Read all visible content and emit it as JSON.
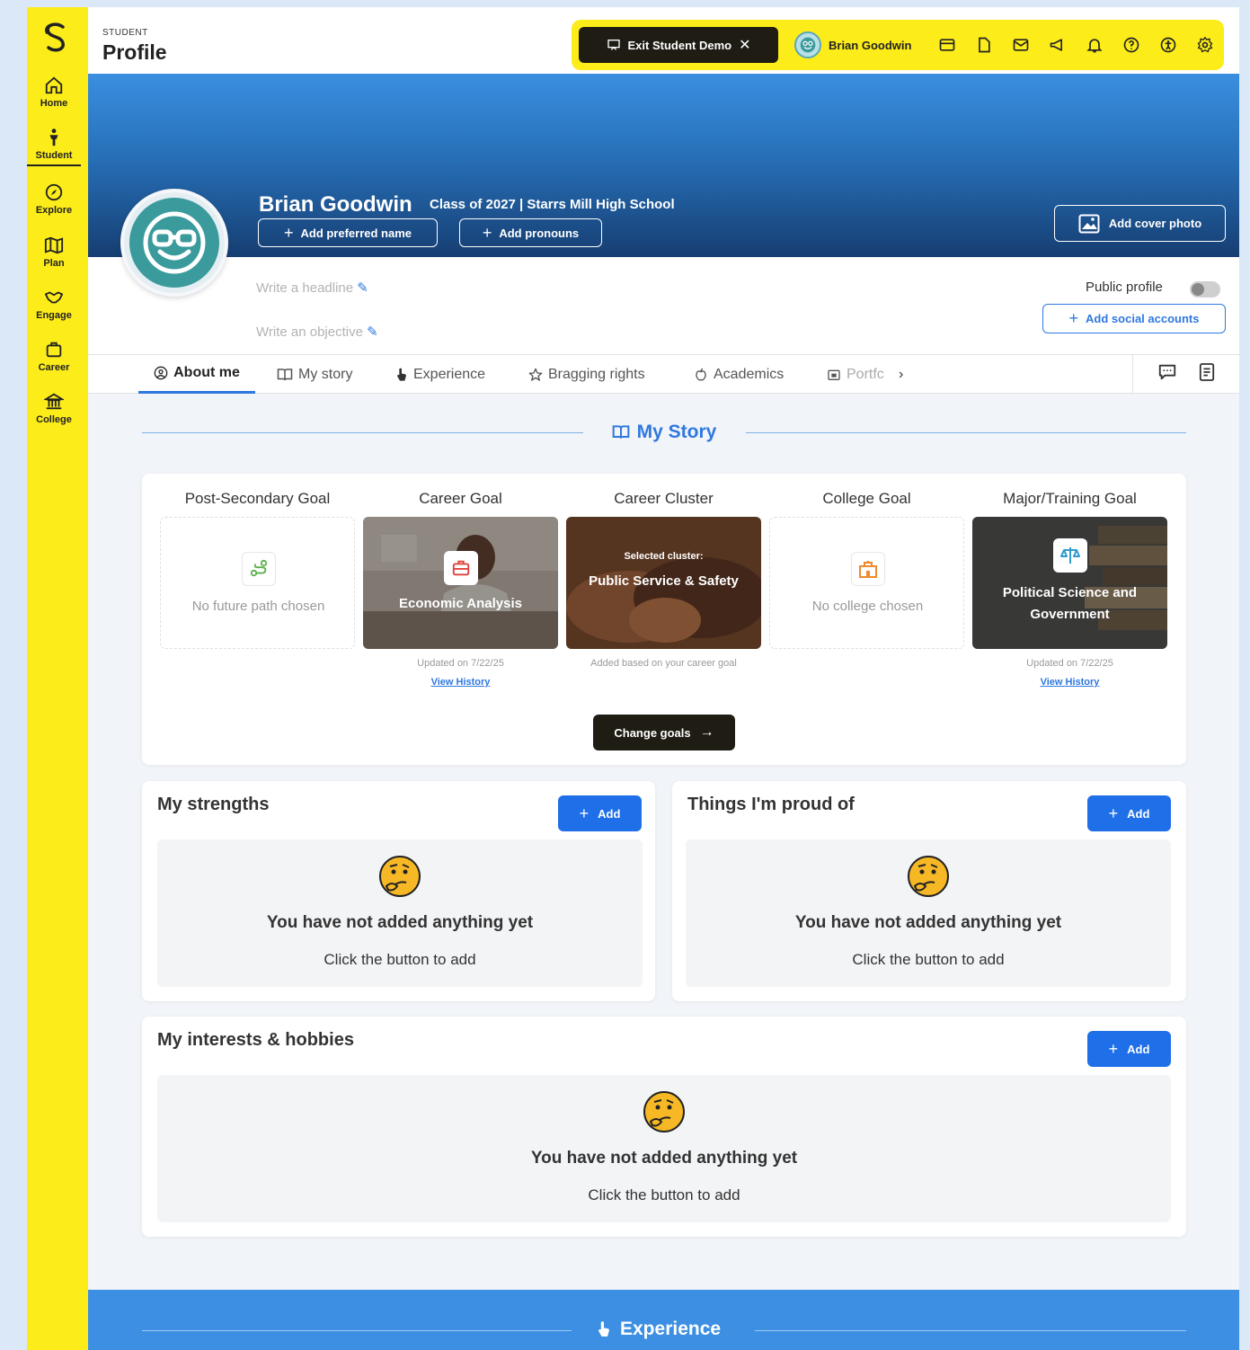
{
  "nav": [
    {
      "label": "Home",
      "icon": "home-icon"
    },
    {
      "label": "Student",
      "icon": "student-icon"
    },
    {
      "label": "Explore",
      "icon": "compass-icon"
    },
    {
      "label": "Plan",
      "icon": "map-icon"
    },
    {
      "label": "Engage",
      "icon": "handshake-icon"
    },
    {
      "label": "Career",
      "icon": "briefcase-icon"
    },
    {
      "label": "College",
      "icon": "college-icon"
    }
  ],
  "header": {
    "section": "STUDENT",
    "title": "Profile",
    "exit_demo": "Exit Student Demo",
    "user_name": "Brian Goodwin"
  },
  "profile": {
    "name": "Brian Goodwin",
    "class_line": "Class of 2027 | Starrs Mill High School",
    "add_preferred_name": "Add preferred name",
    "add_pronouns": "Add pronouns",
    "add_cover_photo": "Add cover photo",
    "headline_placeholder": "Write a headline",
    "objective_placeholder": "Write an objective",
    "public_profile_label": "Public profile",
    "public_profile_on": false,
    "add_social": "Add social accounts"
  },
  "tabs": [
    {
      "label": "About me",
      "active": true
    },
    {
      "label": "My story"
    },
    {
      "label": "Experience"
    },
    {
      "label": "Bragging rights"
    },
    {
      "label": "Academics"
    },
    {
      "label": "Portfc"
    }
  ],
  "my_story": {
    "title": "My Story",
    "goals": [
      {
        "title": "Post-Secondary Goal",
        "empty_text": "No future path chosen"
      },
      {
        "title": "Career Goal",
        "text": "Economic Analysis",
        "meta": "Updated on 7/22/25",
        "link": "View History"
      },
      {
        "title": "Career Cluster",
        "pre": "Selected cluster:",
        "text": "Public Service & Safety",
        "meta": "Added based on your career goal"
      },
      {
        "title": "College Goal",
        "empty_text": "No college chosen"
      },
      {
        "title": "Major/Training Goal",
        "text": "Political Science and Government",
        "meta": "Updated on 7/22/25",
        "link": "View History"
      }
    ],
    "change_goals": "Change goals"
  },
  "strengths": {
    "title": "My strengths",
    "add": "Add",
    "empty_title": "You have not added anything yet",
    "empty_sub": "Click the button to add"
  },
  "proud": {
    "title": "Things I'm proud of",
    "add": "Add",
    "empty_title": "You have not added anything yet",
    "empty_sub": "Click the button to add"
  },
  "interests": {
    "title": "My interests & hobbies",
    "add": "Add",
    "empty_title": "You have not added anything yet",
    "empty_sub": "Click the button to add"
  },
  "experience_section": {
    "title": "Experience"
  },
  "colors": {
    "accent": "#2f78e0",
    "sidebar": "#fcec1a",
    "dark_button": "#1f1c14"
  }
}
